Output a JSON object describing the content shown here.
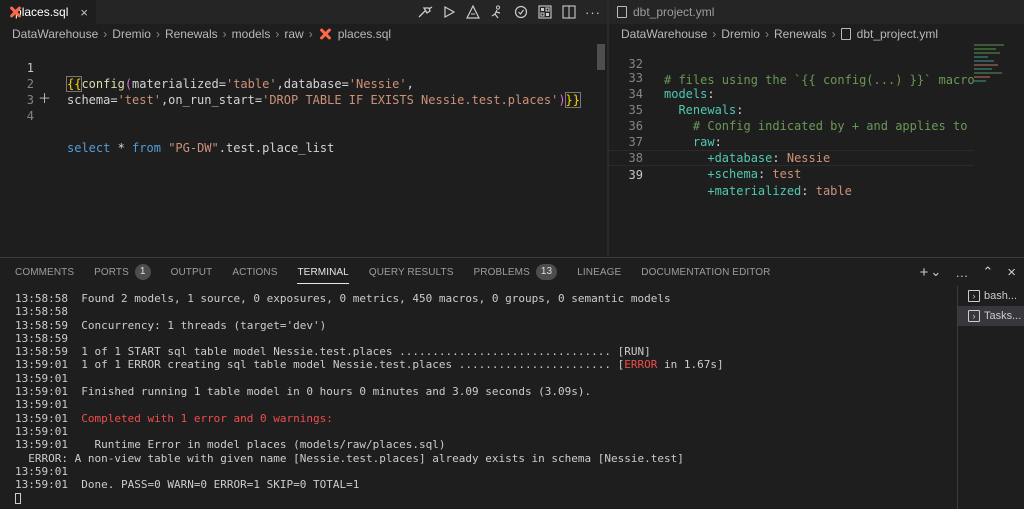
{
  "left_editor": {
    "tab": {
      "label": "places.sql",
      "close": "×"
    },
    "breadcrumb": [
      "DataWarehouse",
      "Dremio",
      "Renewals",
      "models",
      "raw"
    ],
    "breadcrumb_file": "places.sql",
    "lines": [
      {
        "num": "1",
        "text": "{{config(materialized='table',database='Nessie',"
      },
      {
        "num": "2",
        "text": "schema='test',on_run_start='DROP TABLE IF EXISTS Nessie.test.places')}}"
      },
      {
        "num": "3",
        "text": ""
      },
      {
        "num": "4",
        "text": "select * from \"PG-DW\".test.place_list"
      }
    ],
    "toolbar_icons": [
      "compile-icon",
      "run-icon",
      "test-icon",
      "build-icon",
      "check-icon",
      "preview-icon",
      "split-editor-icon",
      "more-actions-icon"
    ]
  },
  "right_editor": {
    "tab": {
      "label": "dbt_project.yml"
    },
    "breadcrumb": [
      "DataWarehouse",
      "Dremio",
      "Renewals"
    ],
    "breadcrumb_file": "dbt_project.yml",
    "lines": [
      {
        "num": "32",
        "text": "# files using the `{{ config(...) }}` macro."
      },
      {
        "num": "33",
        "text": "models:"
      },
      {
        "num": "34",
        "text": "  Renewals:"
      },
      {
        "num": "35",
        "text": "    # Config indicated by + and applies to all fi"
      },
      {
        "num": "36",
        "text": "    raw:"
      },
      {
        "num": "37",
        "text": "      +database: Nessie"
      },
      {
        "num": "38",
        "text": "      +schema: test"
      },
      {
        "num": "39",
        "text": "      +materialized: table"
      }
    ]
  },
  "panel": {
    "tabs": [
      {
        "label": "COMMENTS"
      },
      {
        "label": "PORTS",
        "badge": "1"
      },
      {
        "label": "OUTPUT"
      },
      {
        "label": "ACTIONS"
      },
      {
        "label": "TERMINAL",
        "active": true
      },
      {
        "label": "QUERY RESULTS"
      },
      {
        "label": "PROBLEMS",
        "badge": "13"
      },
      {
        "label": "LINEAGE"
      },
      {
        "label": "DOCUMENTATION EDITOR"
      }
    ],
    "actions": [
      "+",
      "⌄",
      "…",
      "⌃",
      "×"
    ],
    "terminals": [
      {
        "label": "bash..."
      },
      {
        "label": "Tasks..."
      }
    ],
    "terminal_lines": [
      {
        "time": "13:58:58",
        "text": "  Found 2 models, 1 source, 0 exposures, 0 metrics, 450 macros, 0 groups, 0 semantic models"
      },
      {
        "time": "13:58:58",
        "text": ""
      },
      {
        "time": "13:58:59",
        "text": "  Concurrency: 1 threads (target='dev')"
      },
      {
        "time": "13:58:59",
        "text": ""
      },
      {
        "time": "13:58:59",
        "text": "  1 of 1 START sql table model Nessie.test.places ................................ [RUN]"
      },
      {
        "time": "13:59:01",
        "text": "  1 of 1 ERROR creating sql table model Nessie.test.places ....................... [",
        "red": "ERROR",
        "after": " in 1.67s]"
      },
      {
        "time": "13:59:01",
        "text": ""
      },
      {
        "time": "13:59:01",
        "text": "  Finished running 1 table model in 0 hours 0 minutes and 3.09 seconds (3.09s)."
      },
      {
        "time": "13:59:01",
        "text": ""
      },
      {
        "time": "13:59:01",
        "text": "  ",
        "red": "Completed with 1 error and 0 warnings:",
        "after": ""
      },
      {
        "time": "13:59:01",
        "text": ""
      },
      {
        "time": "13:59:01",
        "text": "    Runtime Error in model places (models/raw/places.sql)"
      },
      {
        "time": "",
        "text": "  ERROR: A non-view table with given name [Nessie.test.places] already exists in schema [Nessie.test]"
      },
      {
        "time": "13:59:01",
        "text": ""
      },
      {
        "time": "13:59:01",
        "text": "  Done. PASS=0 WARN=0 ERROR=1 SKIP=0 TOTAL=1"
      }
    ]
  },
  "colors": {
    "accent_orange": "#ff694a",
    "error_red": "#f14c4c",
    "editor_bg": "#1e1e1e"
  }
}
